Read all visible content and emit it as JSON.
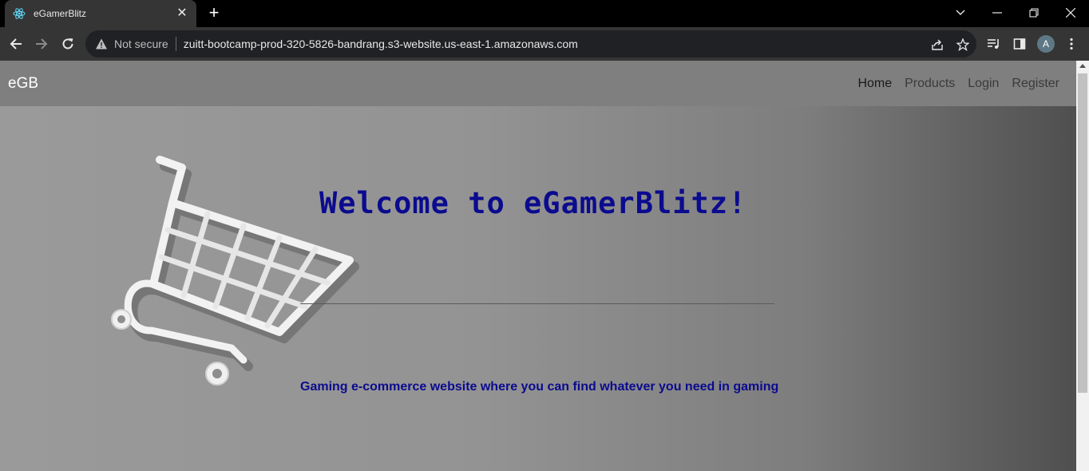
{
  "browser": {
    "tab_title": "eGamerBlitz",
    "tab_favicon": "react-icon",
    "security_label": "Not secure",
    "url": "zuitt-bootcamp-prod-320-5826-bandrang.s3-website.us-east-1.amazonaws.com",
    "profile_initial": "A"
  },
  "site": {
    "brand": "eGB",
    "nav": [
      "Home",
      "Products",
      "Login",
      "Register"
    ],
    "active_nav": "Home"
  },
  "hero": {
    "title": "Welcome to eGamerBlitz!",
    "subtitle": "Gaming e-commerce website where you can find whatever you need in gaming",
    "image": "shopping-cart-image"
  },
  "colors": {
    "hero_text": "#0b0b8f",
    "navbar_bg": "#7f7f7f"
  }
}
